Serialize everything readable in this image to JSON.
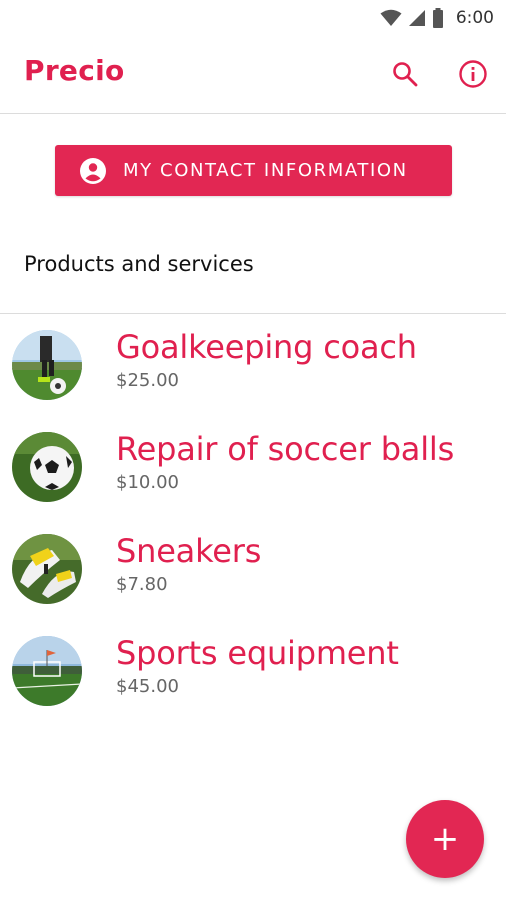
{
  "status_bar": {
    "time": "6:00",
    "icons": [
      "wifi-icon",
      "cellular-signal-icon",
      "battery-icon"
    ]
  },
  "app_bar": {
    "title": "Precio",
    "actions": [
      "search-icon",
      "info-icon"
    ]
  },
  "contact_button": {
    "icon": "account-circle-icon",
    "label": "MY CONTACT INFORMATION"
  },
  "section": {
    "title": "Products and services"
  },
  "products": [
    {
      "name": "Goalkeeping coach",
      "price": "$25.00",
      "image": "goalkeeper-on-field-photo"
    },
    {
      "name": "Repair of soccer balls",
      "price": "$10.00",
      "image": "soccer-ball-on-grass-photo"
    },
    {
      "name": "Sneakers",
      "price": "$7.80",
      "image": "soccer-cleats-photo"
    },
    {
      "name": "Sports equipment",
      "price": "$45.00",
      "image": "soccer-field-goal-photo"
    }
  ],
  "fab": {
    "label": "+",
    "icon": "add-icon"
  },
  "colors": {
    "accent": "#e0204f",
    "button": "#e22753",
    "price": "#666666",
    "divider": "#dcdcdc"
  }
}
